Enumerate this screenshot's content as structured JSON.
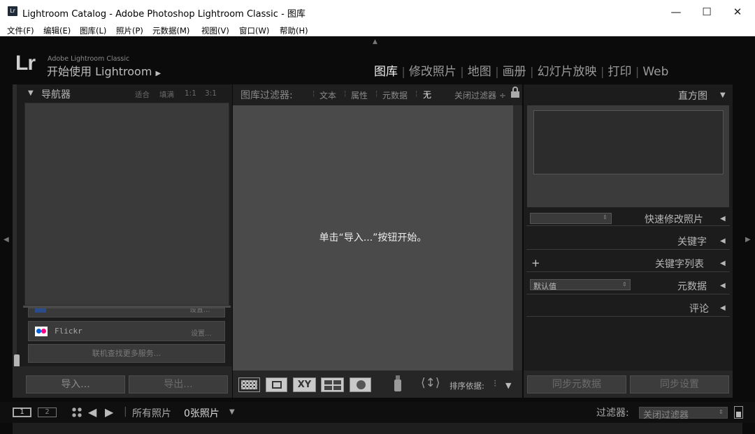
{
  "window": {
    "title": "Lightroom Catalog - Adobe Photoshop Lightroom Classic - 图库",
    "app_badge": "Lr",
    "minimize": "—",
    "maximize": "☐",
    "close": "✕"
  },
  "menu": [
    "文件(F)",
    "编辑(E)",
    "图库(L)",
    "照片(P)",
    "元数据(M)",
    "视图(V)",
    "窗口(W)",
    "帮助(H)"
  ],
  "identity_plate": {
    "logo": "Lr",
    "product": "Adobe Lightroom Classic",
    "tagline": "开始使用 Lightroom",
    "arrow": "▶"
  },
  "modules": [
    {
      "label": "图库",
      "active": true
    },
    {
      "label": "修改照片",
      "active": false
    },
    {
      "label": "地图",
      "active": false
    },
    {
      "label": "画册",
      "active": false
    },
    {
      "label": "幻灯片放映",
      "active": false
    },
    {
      "label": "打印",
      "active": false
    },
    {
      "label": "Web",
      "active": false
    }
  ],
  "navigator": {
    "title": "导航器",
    "zoom": [
      "适合",
      "填满",
      "1:1",
      "3:1"
    ]
  },
  "publish": {
    "partial_service": "Flickr",
    "flickr_label": "Flickr",
    "setup": "设置...",
    "more_services": "联机查找更多服务..."
  },
  "left_buttons": {
    "import": "导入...",
    "export": "导出..."
  },
  "filter_bar": {
    "label": "图库过滤器:",
    "items": [
      "文本",
      "属性",
      "元数据",
      "无"
    ],
    "preset": "关闭过滤器 ÷"
  },
  "main": {
    "empty_message": "单击“导入...”按钮开始。"
  },
  "toolbar": {
    "sort_label": "排序依据:"
  },
  "right_panels": {
    "histogram": "直方图",
    "quick_develop": "快速修改照片",
    "keywording": "关键字",
    "keyword_list": "关键字列表",
    "metadata": "元数据",
    "metadata_preset": "默认值",
    "comments": "评论",
    "add": "+"
  },
  "right_buttons": {
    "sync_metadata": "同步元数据",
    "sync_settings": "同步设置"
  },
  "filmstrip": {
    "page1": "1",
    "page2": "2",
    "source": "所有照片",
    "count": "0张照片",
    "filter_label": "过滤器:",
    "filter_value": "关闭过滤器"
  }
}
